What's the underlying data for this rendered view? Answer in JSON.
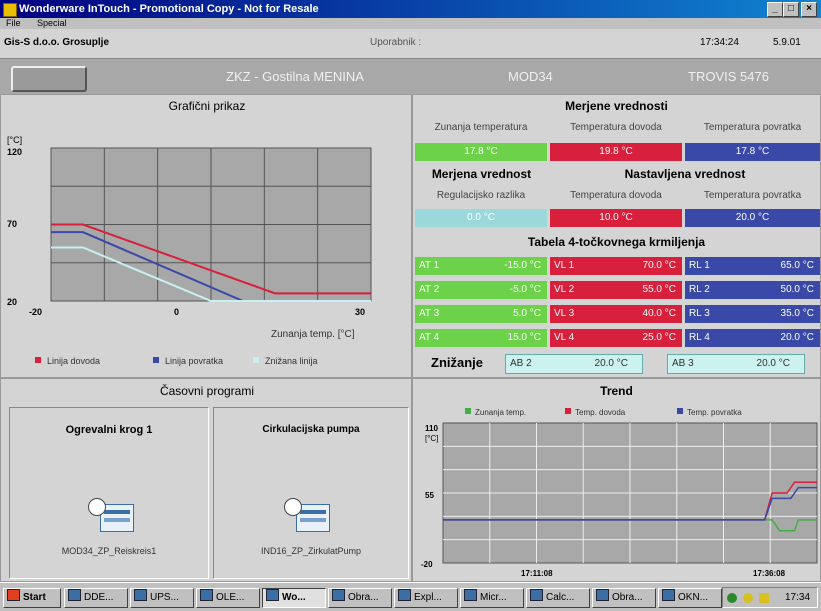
{
  "window": {
    "title": "Wonderware InTouch - Promotional Copy - Not for Resale",
    "minimize": "_",
    "maximize": "□",
    "close": "×"
  },
  "menu": [
    "File",
    "Special"
  ],
  "info": {
    "company": "Gis-S d.o.o. Grosuplje",
    "user_label": "Uporabnik :",
    "time": "17:34:24",
    "date": "5.9.01"
  },
  "header": {
    "location": "ZKZ - Gostilna MENINA",
    "module": "MOD34",
    "controller": "TROVIS 5476"
  },
  "graph_panel": {
    "title": "Grafični prikaz",
    "legend": [
      {
        "label": "Linija dovoda",
        "color": "#d8203c"
      },
      {
        "label": "Linija povratka",
        "color": "#3a48a8"
      },
      {
        "label": "Znižana linija",
        "color": "#c8f0f0"
      }
    ]
  },
  "chart_data": [
    {
      "type": "line",
      "title": "Grafični prikaz",
      "ylabel": "[°C]",
      "xlabel": "Zunanja temp. [°C]",
      "xlim": [
        -20,
        30
      ],
      "ylim": [
        20,
        120
      ],
      "x_ticks": [
        "-20",
        "0",
        "30"
      ],
      "y_ticks": [
        "120",
        "70",
        "20"
      ],
      "grid": true,
      "legend_position": "bottom",
      "series": [
        {
          "name": "Linija dovoda",
          "color": "#d8203c",
          "points": [
            [
              -20,
              70
            ],
            [
              -15,
              70
            ],
            [
              15,
              25
            ],
            [
              30,
              25
            ]
          ]
        },
        {
          "name": "Linija povratka",
          "color": "#3a48a8",
          "points": [
            [
              -20,
              65
            ],
            [
              -15,
              65
            ],
            [
              10,
              20
            ],
            [
              30,
              20
            ]
          ]
        },
        {
          "name": "Znižana linija",
          "color": "#c8f0f0",
          "points": [
            [
              -20,
              55
            ],
            [
              -15,
              55
            ],
            [
              5,
              20
            ],
            [
              30,
              20
            ]
          ]
        }
      ]
    },
    {
      "type": "line",
      "title": "Trend",
      "y_ticks": [
        "110",
        "55",
        "-20"
      ],
      "ylabel": "[°C]",
      "x_ticks": [
        "17:11:08",
        "17:36:08"
      ],
      "ylim": [
        -20,
        110
      ],
      "grid": true,
      "legend_position": "top",
      "series": [
        {
          "name": "Zunanja temp.",
          "color": "#40b040",
          "points": [
            [
              0,
              20
            ],
            [
              0.88,
              20
            ],
            [
              0.9,
              10
            ],
            [
              0.94,
              10
            ],
            [
              0.95,
              20
            ],
            [
              1.0,
              20
            ]
          ]
        },
        {
          "name": "Temp. dovoda",
          "color": "#d8203c",
          "points": [
            [
              0,
              20
            ],
            [
              0.86,
              20
            ],
            [
              0.88,
              45
            ],
            [
              0.92,
              45
            ],
            [
              0.94,
              55
            ],
            [
              1.0,
              55
            ]
          ]
        },
        {
          "name": "Temp. povratka",
          "color": "#3a48a8",
          "points": [
            [
              0,
              20
            ],
            [
              0.86,
              20
            ],
            [
              0.88,
              40
            ],
            [
              0.93,
              40
            ],
            [
              0.95,
              50
            ],
            [
              1.0,
              50
            ]
          ]
        }
      ]
    }
  ],
  "measured": {
    "title": "Merjene vrednosti",
    "labels": [
      "Zunanja temperatura",
      "Temperatura dovoda",
      "Temperatura povratka"
    ],
    "values": [
      "17.8 °C",
      "19.8 °C",
      "17.8 °C"
    ]
  },
  "setpoints": {
    "measured_title": "Merjena vrednost",
    "set_title": "Nastavljena vrednost",
    "labels": [
      "Regulacijsko razlika",
      "Temperatura dovoda",
      "Temperatura povratka"
    ],
    "values": [
      "0.0 °C",
      "10.0 °C",
      "20.0 °C"
    ]
  },
  "table4": {
    "title": "Tabela 4-točkovnega krmiljenja",
    "rows": [
      {
        "at": "AT 1",
        "at_val": "-15.0 °C",
        "vl": "VL 1",
        "vl_val": "70.0 °C",
        "rl": "RL 1",
        "rl_val": "65.0 °C"
      },
      {
        "at": "AT 2",
        "at_val": "-5.0 °C",
        "vl": "VL 2",
        "vl_val": "55.0 °C",
        "rl": "RL 2",
        "rl_val": "50.0 °C"
      },
      {
        "at": "AT 3",
        "at_val": "5.0 °C",
        "vl": "VL 3",
        "vl_val": "40.0 °C",
        "rl": "RL 3",
        "rl_val": "35.0 °C"
      },
      {
        "at": "AT 4",
        "at_val": "15.0 °C",
        "vl": "VL 4",
        "vl_val": "25.0 °C",
        "rl": "RL 4",
        "rl_val": "20.0 °C"
      }
    ],
    "reduction_label": "Znižanje",
    "ab2": "AB 2",
    "ab2_val": "20.0 °C",
    "ab3": "AB 3",
    "ab3_val": "20.0 °C"
  },
  "programs": {
    "title": "Časovni programi",
    "items": [
      {
        "title": "Ogrevalni krog 1",
        "file": "MOD34_ZP_Reiskreis1"
      },
      {
        "title": "Cirkulacijska pumpa",
        "file": "IND16_ZP_ZirkulatPump"
      }
    ]
  },
  "trend": {
    "title": "Trend",
    "legend": [
      {
        "label": "Zunanja temp.",
        "color": "#40b040"
      },
      {
        "label": "Temp. dovoda",
        "color": "#d8203c"
      },
      {
        "label": "Temp. povratka",
        "color": "#3a48a8"
      }
    ]
  },
  "taskbar": {
    "start": "Start",
    "items": [
      "DDE...",
      "UPS...",
      "OLE...",
      "Wo...",
      "Obra...",
      "Expl...",
      "Micr...",
      "Calc...",
      "Obra...",
      "OKN..."
    ],
    "active_index": 3,
    "clock": "17:34"
  }
}
